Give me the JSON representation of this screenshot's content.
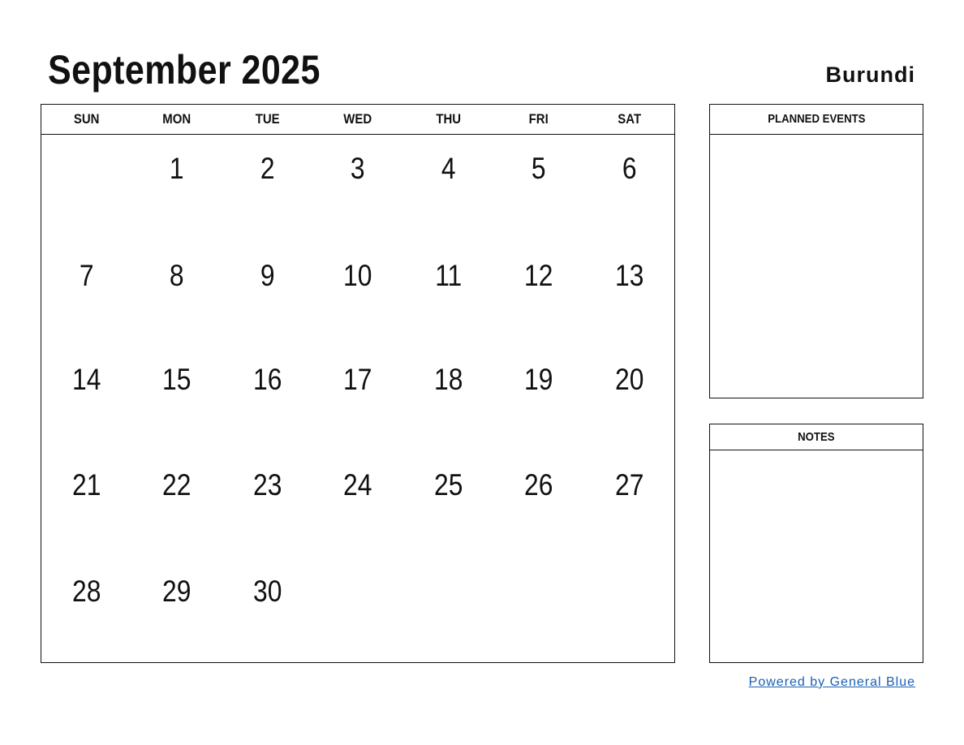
{
  "header": {
    "title": "September 2025",
    "country": "Burundi"
  },
  "calendar": {
    "weekdays": [
      "SUN",
      "MON",
      "TUE",
      "WED",
      "THU",
      "FRI",
      "SAT"
    ],
    "weeks": [
      [
        "",
        "1",
        "2",
        "3",
        "4",
        "5",
        "6"
      ],
      [
        "7",
        "8",
        "9",
        "10",
        "11",
        "12",
        "13"
      ],
      [
        "14",
        "15",
        "16",
        "17",
        "18",
        "19",
        "20"
      ],
      [
        "21",
        "22",
        "23",
        "24",
        "25",
        "26",
        "27"
      ],
      [
        "28",
        "29",
        "30",
        "",
        "",
        "",
        ""
      ]
    ]
  },
  "panels": {
    "planned_events_label": "PLANNED EVENTS",
    "notes_label": "NOTES"
  },
  "footer": {
    "powered_by": "Powered by General Blue",
    "link_color": "#1a5fb4"
  }
}
